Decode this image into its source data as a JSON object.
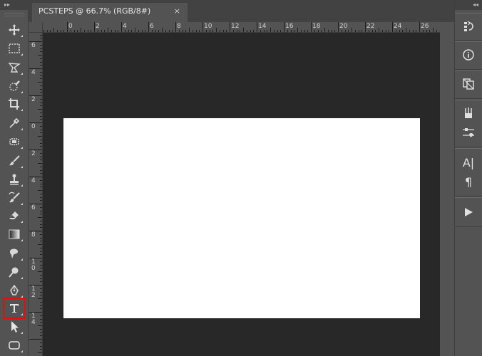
{
  "document_tab": {
    "title": "PCSTEPS @ 66.7% (RGB/8#)",
    "close_glyph": "×"
  },
  "left_toolbar": {
    "collapse_glyph": "▸▸",
    "tools": [
      {
        "name": "move-tool",
        "icon": "move-icon"
      },
      {
        "name": "marquee-tool",
        "icon": "rectangular-marquee-icon"
      },
      {
        "name": "lasso-tool",
        "icon": "polygonal-lasso-icon"
      },
      {
        "name": "quick-selection-tool",
        "icon": "quick-selection-icon"
      },
      {
        "name": "crop-tool",
        "icon": "crop-icon"
      },
      {
        "name": "eyedropper-tool",
        "icon": "eyedropper-icon"
      },
      {
        "name": "healing-brush-tool",
        "icon": "healing-brush-icon"
      },
      {
        "name": "brush-tool",
        "icon": "brush-icon"
      },
      {
        "name": "clone-stamp-tool",
        "icon": "clone-stamp-icon"
      },
      {
        "name": "history-brush-tool",
        "icon": "history-brush-icon"
      },
      {
        "name": "eraser-tool",
        "icon": "eraser-icon"
      },
      {
        "name": "gradient-tool",
        "icon": "gradient-icon"
      },
      {
        "name": "smudge-tool",
        "icon": "smudge-icon"
      },
      {
        "name": "dodge-tool",
        "icon": "dodge-icon"
      },
      {
        "name": "pen-tool",
        "icon": "pen-icon"
      },
      {
        "name": "type-tool",
        "icon": "type-icon",
        "selected": true
      },
      {
        "name": "path-selection-tool",
        "icon": "path-selection-icon"
      },
      {
        "name": "shape-tool",
        "icon": "rounded-rectangle-icon"
      }
    ]
  },
  "rulers": {
    "top_labels": [
      "0",
      "2",
      "4",
      "6",
      "8",
      "10",
      "12",
      "14",
      "16",
      "18",
      "20",
      "22",
      "24",
      "26"
    ],
    "left_labels": [
      "6",
      "4",
      "2",
      "0",
      "2",
      "4",
      "6",
      "8",
      "10",
      "12",
      "14"
    ]
  },
  "right_dock": {
    "collapse_glyph": "◂◂",
    "panels": [
      {
        "name": "history-panel",
        "icon": "history-icon"
      },
      {
        "name": "info-panel",
        "icon": "info-icon"
      },
      {
        "name": "layer-comps-panel",
        "icon": "layer-comps-icon"
      },
      {
        "name": "brushes-panel",
        "icon": "brushes-icon"
      },
      {
        "name": "brush-settings-panel",
        "icon": "brush-settings-icon"
      },
      {
        "name": "character-panel",
        "icon": "character-icon",
        "glyph": "A|"
      },
      {
        "name": "paragraph-panel",
        "icon": "paragraph-icon",
        "glyph": "¶"
      },
      {
        "name": "actions-panel",
        "icon": "play-icon"
      }
    ]
  },
  "colors": {
    "selection_highlight": "#e01010",
    "pasteboard": "#282828",
    "document": "#ffffff",
    "ui": "#535353"
  }
}
